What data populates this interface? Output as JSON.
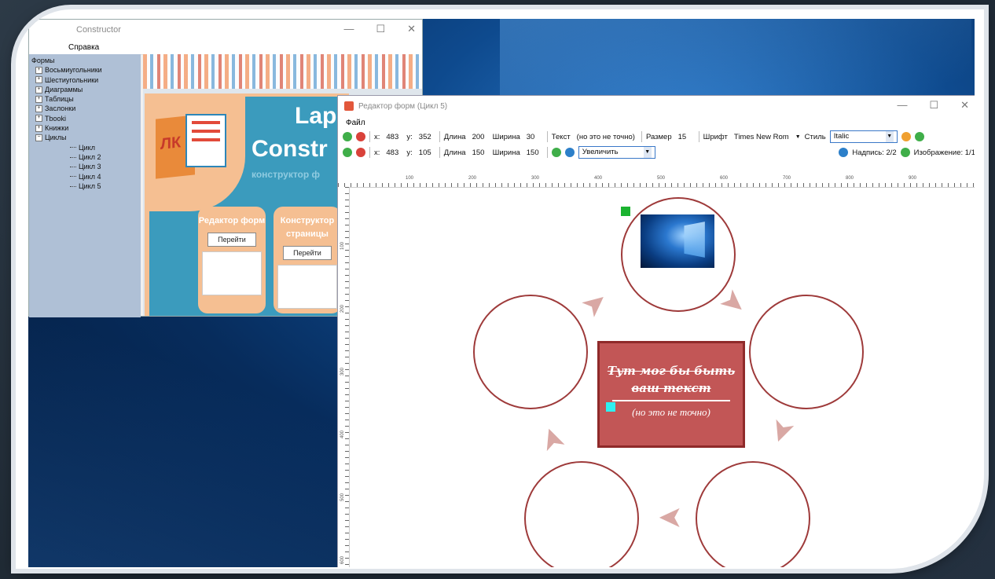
{
  "main_window": {
    "title": "Constructor",
    "menu_help": "Справка",
    "tree": {
      "root": "Формы",
      "groups": [
        "Восьмиугольники",
        "Шестиугольники",
        "Диаграммы",
        "Таблицы",
        "Заслонки",
        "Tbooki",
        "Книжки",
        "Циклы"
      ],
      "cycle_items": [
        "Цикл",
        "Цикл 2",
        "Цикл 3",
        "Цикл 4",
        "Цикл 5"
      ]
    },
    "landing": {
      "title_line1": "Lap",
      "title_line2": "Constr",
      "subtitle": "конструктор ф",
      "logo_letters": "ЛК",
      "card1_title": "Редактор форм",
      "card2_title": "Конструктор страницы",
      "go_button": "Перейти"
    }
  },
  "editor": {
    "title": "Редактор форм (Цикл 5)",
    "menu_file": "Файл",
    "row1": {
      "x_label": "x:",
      "x": "483",
      "y_label": "y:",
      "y": "352",
      "length_label": "Длина",
      "length": "200",
      "width_label": "Ширина",
      "width": "30",
      "text_label": "Текст",
      "text": "(но это не точно)",
      "size_label": "Размер",
      "size": "15",
      "font_label": "Шрифт",
      "font": "Times New Rom",
      "style_label": "Стиль",
      "style": "Italic"
    },
    "row2": {
      "x_label": "x:",
      "x": "483",
      "y_label": "y:",
      "y": "105",
      "length_label": "Длина",
      "length": "150",
      "width_label": "Ширина",
      "width": "150",
      "action": "Увеличить",
      "captions": "Надпись: 2/2",
      "images": "Изображение: 1/1"
    },
    "ruler_h": [
      "100",
      "200",
      "300",
      "400",
      "500",
      "600",
      "700",
      "800",
      "900"
    ],
    "ruler_v": [
      "100",
      "200",
      "300",
      "400",
      "500",
      "600"
    ],
    "canvas": {
      "main_text": "Тут мог бы быть ваш текст",
      "sub_text": "(но это не точно)"
    }
  },
  "colors": {
    "circle_border": "#9e3a3a",
    "center_fill": "#c25656",
    "arrow": "#d9a8a4",
    "tree_bg": "#afc0d6"
  }
}
